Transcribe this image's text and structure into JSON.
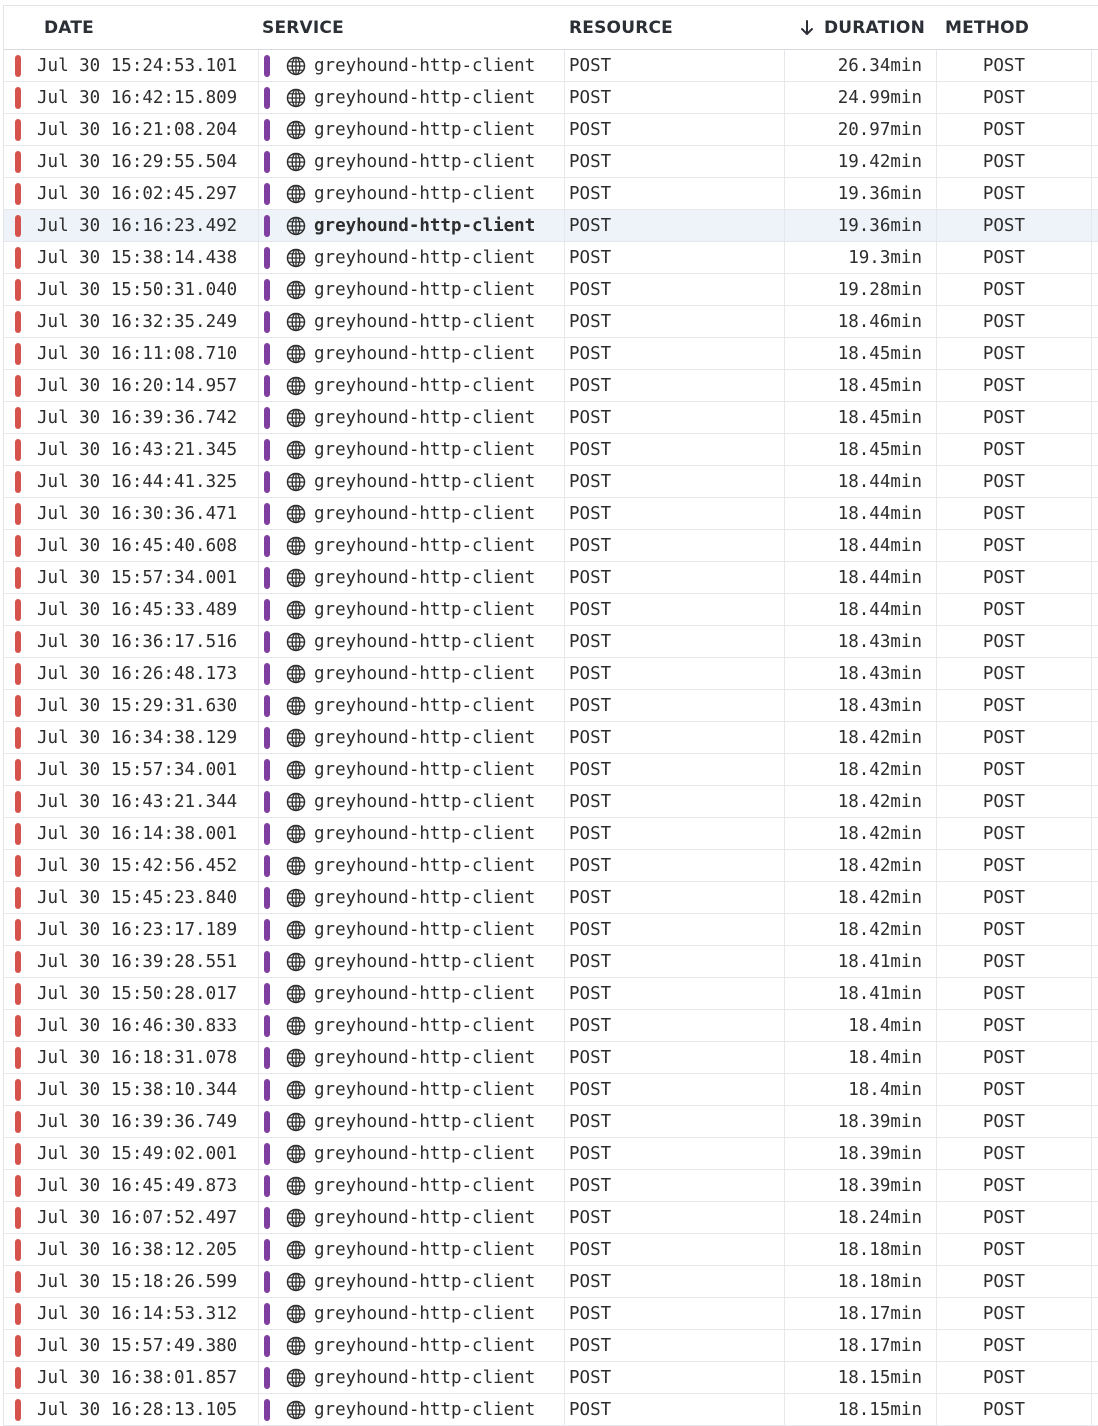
{
  "columns": {
    "date": "DATE",
    "service": "SERVICE",
    "resource": "RESOURCE",
    "duration": "DURATION",
    "method": "METHOD",
    "sort_icon": "arrow-down-icon"
  },
  "colors": {
    "status_error": "#d6524c",
    "service": "#7f3fa0",
    "selected_row": "#edf3f8"
  },
  "selected_row_index": 5,
  "rows": [
    {
      "date": "Jul 30 15:24:53.101",
      "service": "greyhound-http-client",
      "resource": "POST",
      "duration": "26.34min",
      "method": "POST"
    },
    {
      "date": "Jul 30 16:42:15.809",
      "service": "greyhound-http-client",
      "resource": "POST",
      "duration": "24.99min",
      "method": "POST"
    },
    {
      "date": "Jul 30 16:21:08.204",
      "service": "greyhound-http-client",
      "resource": "POST",
      "duration": "20.97min",
      "method": "POST"
    },
    {
      "date": "Jul 30 16:29:55.504",
      "service": "greyhound-http-client",
      "resource": "POST",
      "duration": "19.42min",
      "method": "POST"
    },
    {
      "date": "Jul 30 16:02:45.297",
      "service": "greyhound-http-client",
      "resource": "POST",
      "duration": "19.36min",
      "method": "POST"
    },
    {
      "date": "Jul 30 16:16:23.492",
      "service": "greyhound-http-client",
      "resource": "POST",
      "duration": "19.36min",
      "method": "POST"
    },
    {
      "date": "Jul 30 15:38:14.438",
      "service": "greyhound-http-client",
      "resource": "POST",
      "duration": "19.3min",
      "method": "POST"
    },
    {
      "date": "Jul 30 15:50:31.040",
      "service": "greyhound-http-client",
      "resource": "POST",
      "duration": "19.28min",
      "method": "POST"
    },
    {
      "date": "Jul 30 16:32:35.249",
      "service": "greyhound-http-client",
      "resource": "POST",
      "duration": "18.46min",
      "method": "POST"
    },
    {
      "date": "Jul 30 16:11:08.710",
      "service": "greyhound-http-client",
      "resource": "POST",
      "duration": "18.45min",
      "method": "POST"
    },
    {
      "date": "Jul 30 16:20:14.957",
      "service": "greyhound-http-client",
      "resource": "POST",
      "duration": "18.45min",
      "method": "POST"
    },
    {
      "date": "Jul 30 16:39:36.742",
      "service": "greyhound-http-client",
      "resource": "POST",
      "duration": "18.45min",
      "method": "POST"
    },
    {
      "date": "Jul 30 16:43:21.345",
      "service": "greyhound-http-client",
      "resource": "POST",
      "duration": "18.45min",
      "method": "POST"
    },
    {
      "date": "Jul 30 16:44:41.325",
      "service": "greyhound-http-client",
      "resource": "POST",
      "duration": "18.44min",
      "method": "POST"
    },
    {
      "date": "Jul 30 16:30:36.471",
      "service": "greyhound-http-client",
      "resource": "POST",
      "duration": "18.44min",
      "method": "POST"
    },
    {
      "date": "Jul 30 16:45:40.608",
      "service": "greyhound-http-client",
      "resource": "POST",
      "duration": "18.44min",
      "method": "POST"
    },
    {
      "date": "Jul 30 15:57:34.001",
      "service": "greyhound-http-client",
      "resource": "POST",
      "duration": "18.44min",
      "method": "POST"
    },
    {
      "date": "Jul 30 16:45:33.489",
      "service": "greyhound-http-client",
      "resource": "POST",
      "duration": "18.44min",
      "method": "POST"
    },
    {
      "date": "Jul 30 16:36:17.516",
      "service": "greyhound-http-client",
      "resource": "POST",
      "duration": "18.43min",
      "method": "POST"
    },
    {
      "date": "Jul 30 16:26:48.173",
      "service": "greyhound-http-client",
      "resource": "POST",
      "duration": "18.43min",
      "method": "POST"
    },
    {
      "date": "Jul 30 15:29:31.630",
      "service": "greyhound-http-client",
      "resource": "POST",
      "duration": "18.43min",
      "method": "POST"
    },
    {
      "date": "Jul 30 16:34:38.129",
      "service": "greyhound-http-client",
      "resource": "POST",
      "duration": "18.42min",
      "method": "POST"
    },
    {
      "date": "Jul 30 15:57:34.001",
      "service": "greyhound-http-client",
      "resource": "POST",
      "duration": "18.42min",
      "method": "POST"
    },
    {
      "date": "Jul 30 16:43:21.344",
      "service": "greyhound-http-client",
      "resource": "POST",
      "duration": "18.42min",
      "method": "POST"
    },
    {
      "date": "Jul 30 16:14:38.001",
      "service": "greyhound-http-client",
      "resource": "POST",
      "duration": "18.42min",
      "method": "POST"
    },
    {
      "date": "Jul 30 15:42:56.452",
      "service": "greyhound-http-client",
      "resource": "POST",
      "duration": "18.42min",
      "method": "POST"
    },
    {
      "date": "Jul 30 15:45:23.840",
      "service": "greyhound-http-client",
      "resource": "POST",
      "duration": "18.42min",
      "method": "POST"
    },
    {
      "date": "Jul 30 16:23:17.189",
      "service": "greyhound-http-client",
      "resource": "POST",
      "duration": "18.42min",
      "method": "POST"
    },
    {
      "date": "Jul 30 16:39:28.551",
      "service": "greyhound-http-client",
      "resource": "POST",
      "duration": "18.41min",
      "method": "POST"
    },
    {
      "date": "Jul 30 15:50:28.017",
      "service": "greyhound-http-client",
      "resource": "POST",
      "duration": "18.41min",
      "method": "POST"
    },
    {
      "date": "Jul 30 16:46:30.833",
      "service": "greyhound-http-client",
      "resource": "POST",
      "duration": "18.4min",
      "method": "POST"
    },
    {
      "date": "Jul 30 16:18:31.078",
      "service": "greyhound-http-client",
      "resource": "POST",
      "duration": "18.4min",
      "method": "POST"
    },
    {
      "date": "Jul 30 15:38:10.344",
      "service": "greyhound-http-client",
      "resource": "POST",
      "duration": "18.4min",
      "method": "POST"
    },
    {
      "date": "Jul 30 16:39:36.749",
      "service": "greyhound-http-client",
      "resource": "POST",
      "duration": "18.39min",
      "method": "POST"
    },
    {
      "date": "Jul 30 15:49:02.001",
      "service": "greyhound-http-client",
      "resource": "POST",
      "duration": "18.39min",
      "method": "POST"
    },
    {
      "date": "Jul 30 16:45:49.873",
      "service": "greyhound-http-client",
      "resource": "POST",
      "duration": "18.39min",
      "method": "POST"
    },
    {
      "date": "Jul 30 16:07:52.497",
      "service": "greyhound-http-client",
      "resource": "POST",
      "duration": "18.24min",
      "method": "POST"
    },
    {
      "date": "Jul 30 16:38:12.205",
      "service": "greyhound-http-client",
      "resource": "POST",
      "duration": "18.18min",
      "method": "POST"
    },
    {
      "date": "Jul 30 15:18:26.599",
      "service": "greyhound-http-client",
      "resource": "POST",
      "duration": "18.18min",
      "method": "POST"
    },
    {
      "date": "Jul 30 16:14:53.312",
      "service": "greyhound-http-client",
      "resource": "POST",
      "duration": "18.17min",
      "method": "POST"
    },
    {
      "date": "Jul 30 15:57:49.380",
      "service": "greyhound-http-client",
      "resource": "POST",
      "duration": "18.17min",
      "method": "POST"
    },
    {
      "date": "Jul 30 16:38:01.857",
      "service": "greyhound-http-client",
      "resource": "POST",
      "duration": "18.15min",
      "method": "POST"
    },
    {
      "date": "Jul 30 16:28:13.105",
      "service": "greyhound-http-client",
      "resource": "POST",
      "duration": "18.15min",
      "method": "POST"
    }
  ]
}
